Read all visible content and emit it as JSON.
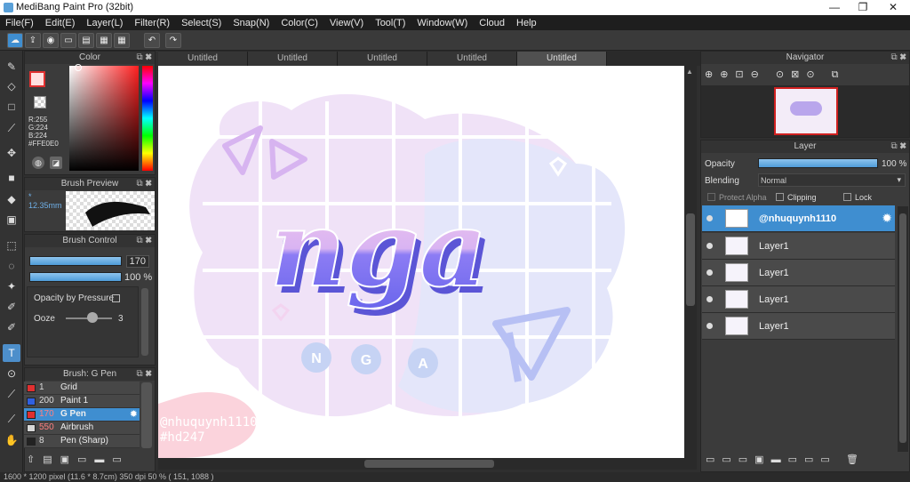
{
  "app": {
    "title": "MediBang Paint Pro (32bit)"
  },
  "window_controls": {
    "minimize": "—",
    "maximize": "❐",
    "close": "✕"
  },
  "menu": [
    "File(F)",
    "Edit(E)",
    "Layer(L)",
    "Filter(R)",
    "Select(S)",
    "Snap(N)",
    "Color(C)",
    "View(V)",
    "Tool(T)",
    "Window(W)",
    "Cloud",
    "Help"
  ],
  "tabs": [
    "Untitled",
    "Untitled",
    "Untitled",
    "Untitled",
    "Untitled"
  ],
  "active_tab": 4,
  "color_panel": {
    "title": "Color",
    "primary": "#FFE0E0",
    "r": "R:255",
    "g": "G:224",
    "b": "B:224",
    "hex": "#FFE0E0"
  },
  "brush_preview": {
    "title": "Brush Preview",
    "size_label": "* 12.35mm"
  },
  "brush_control": {
    "title": "Brush Control",
    "size_value": "170",
    "opacity_value": "100 %",
    "opacity_by_pressure": "Opacity by Pressure",
    "ooze_label": "Ooze",
    "ooze_value": "3"
  },
  "brush_list": {
    "title": "Brush: G Pen",
    "items": [
      {
        "size": "1",
        "name": "Grid",
        "color": "#e03030"
      },
      {
        "size": "200",
        "name": "Paint 1",
        "color": "#3060e0"
      },
      {
        "size": "170",
        "name": "G Pen",
        "color": "#e03030",
        "selected": true
      },
      {
        "size": "550",
        "name": "Airbrush",
        "color": "#d8d8d8"
      },
      {
        "size": "8",
        "name": "Pen (Sharp)",
        "color": "#222222"
      }
    ]
  },
  "navigator": {
    "title": "Navigator"
  },
  "layer_panel": {
    "title": "Layer",
    "opacity_label": "Opacity",
    "opacity_value": "100 %",
    "blending_label": "Blending",
    "blending_value": "Normal",
    "protect_alpha": "Protect Alpha",
    "clipping": "Clipping",
    "lock": "Lock",
    "layers": [
      {
        "name": "@nhuquynh1110",
        "selected": true
      },
      {
        "name": "Layer1"
      },
      {
        "name": "Layer1"
      },
      {
        "name": "Layer1"
      },
      {
        "name": "Layer1"
      }
    ]
  },
  "canvas_art": {
    "text": "nga",
    "badges": [
      "N",
      "G",
      "A"
    ],
    "watermark_line1": "@nhuquynh1110",
    "watermark_line2": "#hd247"
  },
  "status": {
    "text": "1600 * 1200 pixel   (11.6 * 8.7cm)   350 dpi   50 %   ( 151, 1088 )"
  },
  "colors": {
    "accent": "#3f8ed0",
    "panel": "#3b3b3b"
  }
}
